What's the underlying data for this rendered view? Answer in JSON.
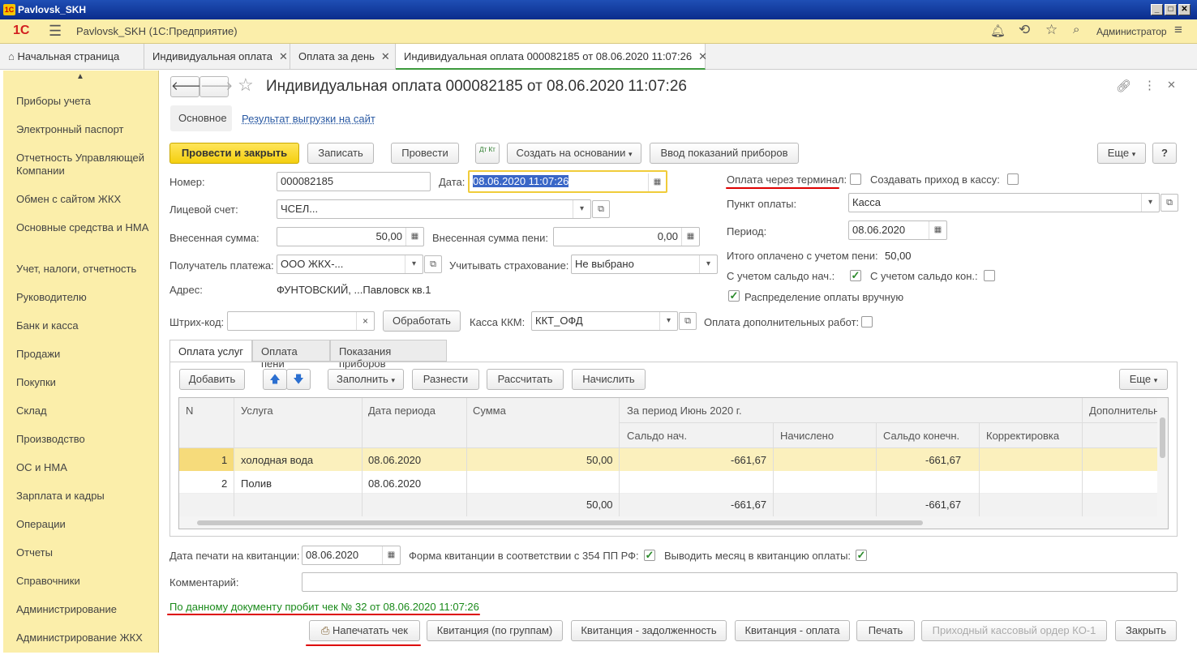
{
  "window": {
    "title": "Pavlovsk_SKH"
  },
  "app": {
    "title": "Pavlovsk_SKH  (1С:Предприятие)",
    "user": "Администратор",
    "logo": "1С"
  },
  "tabs": [
    {
      "label": "Начальная страница"
    },
    {
      "label": "Индивидуальная оплата"
    },
    {
      "label": "Оплата за день"
    },
    {
      "label": "Индивидуальная оплата 000082185 от 08.06.2020 11:07:26"
    }
  ],
  "sidebar": {
    "items": [
      "Приборы учета",
      "Электронный паспорт",
      "Отчетность Управляющей Компании",
      "Обмен с сайтом ЖКХ",
      "Основные средства и НМА",
      "Учет, налоги, отчетность",
      "Руководителю",
      "Банк и касса",
      "Продажи",
      "Покупки",
      "Склад",
      "Производство",
      "ОС и НМА",
      "Зарплата и кадры",
      "Операции",
      "Отчеты",
      "Справочники",
      "Администрирование",
      "Администрирование ЖКХ"
    ]
  },
  "doc": {
    "title": "Индивидуальная оплата 000082185 от 08.06.2020 11:07:26",
    "subtabs": [
      "Основное",
      "Результат выгрузки на сайт"
    ],
    "toolbar": {
      "post_close": "Провести и закрыть",
      "save": "Записать",
      "post": "Провести",
      "dtkt": "Дт Кт",
      "create_based": "Создать на основании",
      "meter_input": "Ввод показаний приборов",
      "more": "Еще",
      "help": "?"
    },
    "fields": {
      "number_label": "Номер:",
      "number": "000082185",
      "date_label": "Дата:",
      "date": "08.06.2020 11:07:26",
      "account_label": "Лицевой счет:",
      "account": "ЧСЕЛ...",
      "sum_label": "Внесенная сумма:",
      "sum": "50,00",
      "penalty_label": "Внесенная сумма пени:",
      "penalty": "0,00",
      "recipient_label": "Получатель платежа:",
      "recipient": "ООО ЖКХ-...",
      "insurance_label": "Учитывать страхование:",
      "insurance": "Не выбрано",
      "address_label": "Адрес:",
      "address": "ФУНТОВСКИЙ, ...Павловск кв.1",
      "barcode_label": "Штрих-код:",
      "process": "Обработать",
      "kkm_label": "Касса ККМ:",
      "kkm": "ККТ_ОФД",
      "extra_works_label": "Оплата дополнительных работ:",
      "terminal_label": "Оплата через терминал:",
      "cash_in_label": "Создавать приход в кассу:",
      "point_label": "Пункт оплаты:",
      "point": "Касса",
      "period_label": "Период:",
      "period": "08.06.2020",
      "total_label": "Итого оплачено с учетом пени:",
      "total": "50,00",
      "saldo_start_label": "С учетом сальдо нач.:",
      "saldo_end_label": "С учетом сальдо кон.:",
      "manual_dist_label": "Распределение оплаты вручную"
    },
    "sections": [
      "Оплата услуг",
      "Оплата пени",
      "Показания приборов"
    ],
    "tbl_toolbar": {
      "add": "Добавить",
      "fill": "Заполнить",
      "distribute": "Разнести",
      "calculate": "Рассчитать",
      "accrue": "Начислить",
      "more": "Еще"
    },
    "table": {
      "headers": {
        "n": "N",
        "service": "Услуга",
        "period_date": "Дата периода",
        "sum": "Сумма",
        "group": "За период Июнь 2020 г.",
        "saldo_start": "Сальдо нач.",
        "accrued": "Начислено",
        "saldo_end": "Сальдо конечн.",
        "correction": "Корректировка",
        "extra": "Дополнительн"
      },
      "rows": [
        {
          "n": "1",
          "service": "холодная вода",
          "period_date": "08.06.2020",
          "sum": "50,00",
          "saldo_start": "-661,67",
          "saldo_end": "-661,67"
        },
        {
          "n": "2",
          "service": "Полив",
          "period_date": "08.06.2020",
          "sum": "",
          "saldo_start": "",
          "saldo_end": ""
        }
      ],
      "totals": {
        "sum": "50,00",
        "saldo_start": "-661,67",
        "saldo_end": "-661,67"
      }
    },
    "bottom": {
      "print_date_label": "Дата печати на квитанции:",
      "print_date": "08.06.2020",
      "form354_label": "Форма квитанции в соответствии с 354 ПП РФ:",
      "month_label": "Выводить месяц в квитанцию оплаты:",
      "comment_label": "Комментарий:",
      "receipt_status": "По данному документу пробит чек № 32 от 08.06.2020 11:07:26"
    },
    "footer_buttons": [
      "Напечатать чек",
      "Квитанция (по группам)",
      "Квитанция - задолженность",
      "Квитанция - оплата",
      "Печать",
      "Приходный кассовый ордер КО-1",
      "Закрыть"
    ]
  }
}
